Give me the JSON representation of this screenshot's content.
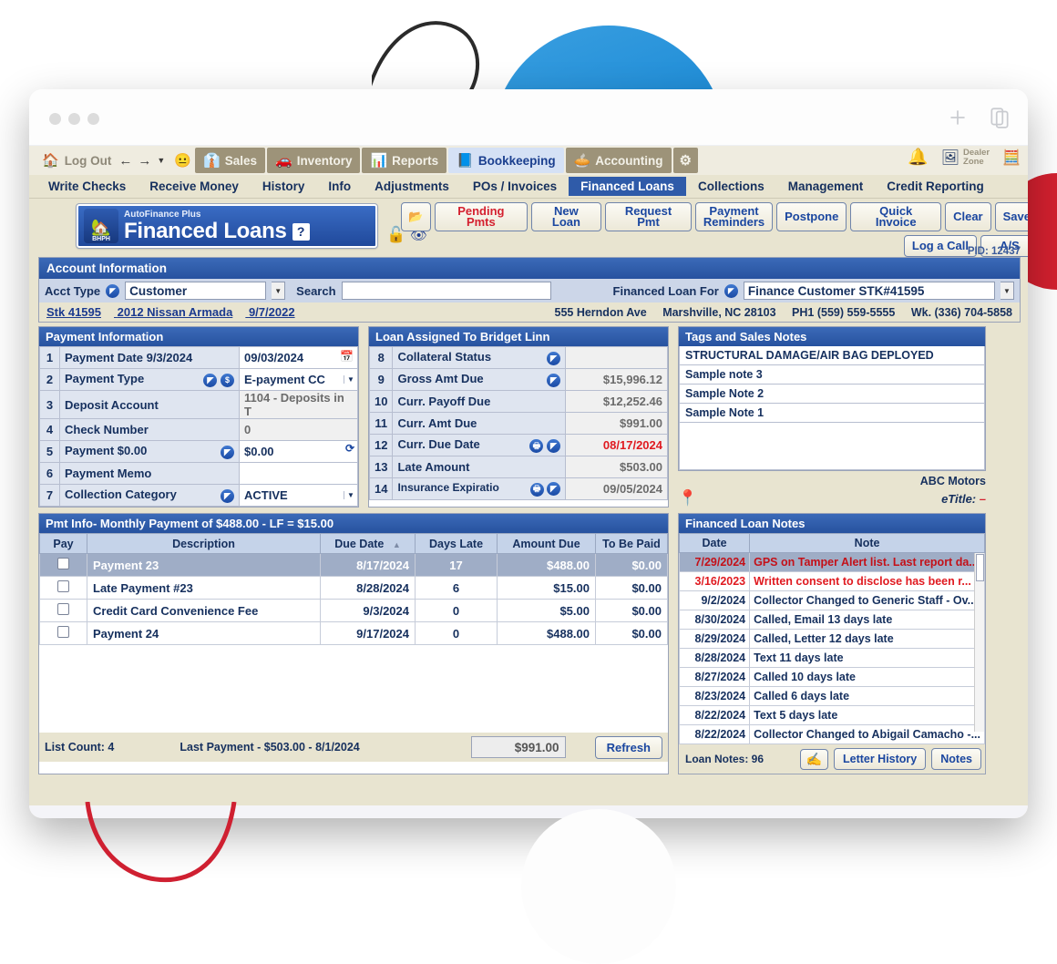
{
  "window": {
    "traffic_dots": [
      "close",
      "minimize",
      "maximize"
    ],
    "actions": [
      "new-tab-plus",
      "copy-tabs"
    ]
  },
  "module_bar": {
    "home_icon": "home-icon",
    "logout_label": "Log Out",
    "back_icon": "back-arrow-icon",
    "forward_icon": "forward-arrow-icon",
    "dropdown_icon": "chevron-down-icon",
    "face_icon": "face-icon",
    "tabs": [
      {
        "label": "Sales",
        "icon": "salesperson-icon",
        "active": false
      },
      {
        "label": "Inventory",
        "icon": "car-icon",
        "active": false
      },
      {
        "label": "Reports",
        "icon": "report-icon",
        "active": false
      },
      {
        "label": "Bookkeeping",
        "icon": "book-icon",
        "active": true
      },
      {
        "label": "Accounting",
        "icon": "pie-chart-icon",
        "active": false
      }
    ],
    "settings_icon": "gear-icon",
    "bell_icon": "bell-icon",
    "dealer_zone_line1": "Dealer",
    "dealer_zone_line2": "Zone",
    "calculator_icon": "calculator-icon"
  },
  "sub_nav": {
    "items": [
      {
        "label": "Write Checks",
        "active": false
      },
      {
        "label": "Receive Money",
        "active": false
      },
      {
        "label": "History",
        "active": false
      },
      {
        "label": "Info",
        "active": false
      },
      {
        "label": "Adjustments",
        "active": false
      },
      {
        "label": "POs / Invoices",
        "active": false
      },
      {
        "label": "Financed Loans",
        "active": true
      },
      {
        "label": "Collections",
        "active": false
      },
      {
        "label": "Management",
        "active": false
      },
      {
        "label": "Credit Reporting",
        "active": false
      }
    ]
  },
  "banner": {
    "logo_text": "BHPH",
    "product": "AutoFinance Plus",
    "title": "Financed Loans",
    "help_glyph": "?",
    "lock_icon": "unlock-icon",
    "eye_icon": "eye-icon"
  },
  "toolbar": {
    "row1": [
      {
        "label": "",
        "name": "folder-button",
        "icon": "folder-icon"
      },
      {
        "label": "Pending Pmts",
        "name": "pending-pmts-button",
        "red": true
      },
      {
        "label": "New Loan",
        "name": "new-loan-button"
      },
      {
        "label": "Request Pmt",
        "name": "request-pmt-button"
      },
      {
        "label": "Payment\nReminders",
        "name": "payment-reminders-button"
      },
      {
        "label": "Postpone",
        "name": "postpone-button"
      },
      {
        "label": "Quick Invoice",
        "name": "quick-invoice-button"
      },
      {
        "label": "Clear",
        "name": "clear-button"
      },
      {
        "label": "Save",
        "name": "save-button"
      }
    ],
    "row2": [
      {
        "label": "Log a Call",
        "name": "log-a-call-button"
      },
      {
        "label": "A/S",
        "name": "as-button"
      }
    ],
    "pid": "PID: 12437"
  },
  "account": {
    "panel_title": "Account Information",
    "acct_type_label": "Acct Type",
    "acct_type_value": "Customer",
    "search_label": "Search",
    "search_value": "",
    "search_placeholder": "",
    "financed_loan_for_label": "Financed Loan For",
    "financed_loan_for_value": "Finance Customer STK#41595",
    "stock": "Stk 41595",
    "vehicle": "2012 Nissan Armada",
    "date": "9/7/2022",
    "address": "555 Herndon Ave",
    "city_state_zip": "Marshville, NC 28103",
    "phone1": "PH1 (559) 559-5555",
    "phone2": "Wk. (336) 704-5858"
  },
  "payment_information": {
    "panel_title": "Payment Information",
    "rows": [
      {
        "n": "1",
        "label": "Payment Date  9/3/2024",
        "value": "09/03/2024",
        "readonly": false,
        "icons": [],
        "trail_icon": "calendar-icon",
        "caret": false
      },
      {
        "n": "2",
        "label": "Payment Type",
        "value": "E-payment CC",
        "readonly": false,
        "icons": [
          "lookup-icon",
          "dollar-icon"
        ],
        "caret": true
      },
      {
        "n": "3",
        "label": "Deposit Account",
        "value": "1104 - Deposits in T",
        "readonly": true,
        "icons": [],
        "caret": false
      },
      {
        "n": "4",
        "label": "Check Number",
        "value": "0",
        "readonly": true,
        "icons": [],
        "caret": false
      },
      {
        "n": "5",
        "label": "Payment  $0.00",
        "value": "$0.00",
        "readonly": false,
        "icons": [
          "lookup-icon"
        ],
        "trail_icon": "refresh-icon",
        "caret": false
      },
      {
        "n": "6",
        "label": "Payment Memo",
        "value": "",
        "readonly": false,
        "icons": [],
        "caret": false
      },
      {
        "n": "7",
        "label": "Collection Category",
        "value": "ACTIVE",
        "readonly": false,
        "icons": [
          "lookup-icon"
        ],
        "caret": true
      }
    ]
  },
  "loan_assigned": {
    "panel_title": "Loan Assigned To Bridget Linn",
    "rows": [
      {
        "n": "8",
        "label": "Collateral Status",
        "value": "",
        "icons": [
          "lookup-icon"
        ],
        "red": false
      },
      {
        "n": "9",
        "label": "Gross Amt Due",
        "value": "$15,996.12",
        "icons": [
          "lookup-icon"
        ],
        "red": false
      },
      {
        "n": "10",
        "label": "Curr. Payoff Due",
        "value": "$12,252.46",
        "icons": [],
        "red": false
      },
      {
        "n": "11",
        "label": "Curr. Amt Due",
        "value": "$991.00",
        "icons": [],
        "red": false
      },
      {
        "n": "12",
        "label": "Curr. Due Date",
        "value": "08/17/2024",
        "icons": [
          "print-icon",
          "lookup-icon"
        ],
        "red": true
      },
      {
        "n": "13",
        "label": "Late Amount",
        "value": "$503.00",
        "icons": [],
        "red": false
      },
      {
        "n": "14",
        "label": "Insurance Expiratio",
        "value": "09/05/2024",
        "icons": [
          "print-icon",
          "lookup-icon"
        ],
        "red": false
      }
    ]
  },
  "tags_and_sales_notes": {
    "panel_title": "Tags and Sales Notes",
    "items": [
      "STRUCTURAL DAMAGE/AIR BAG DEPLOYED",
      "Sample note 3",
      "Sample Note 2",
      "Sample Note 1"
    ],
    "dealer": "ABC Motors",
    "etitle_label": "eTitle:",
    "etitle_value": "–",
    "pin_icon": "map-pin-icon"
  },
  "pmt_info": {
    "panel_title": "Pmt Info- Monthly Payment of $488.00 - LF = $15.00",
    "columns": [
      "Pay",
      "Description",
      "Due Date",
      "Days Late",
      "Amount Due",
      "To Be Paid"
    ],
    "sort_column": "Due Date",
    "sort_dir": "asc",
    "rows": [
      {
        "pay": false,
        "description": "Payment 23",
        "due_date": "8/17/2024",
        "days_late": "17",
        "amount_due": "$488.00",
        "to_be_paid": "$0.00",
        "selected": true
      },
      {
        "pay": false,
        "description": "Late Payment #23",
        "due_date": "8/28/2024",
        "days_late": "6",
        "amount_due": "$15.00",
        "to_be_paid": "$0.00",
        "selected": false
      },
      {
        "pay": false,
        "description": "Credit Card Convenience Fee",
        "due_date": "9/3/2024",
        "days_late": "0",
        "amount_due": "$5.00",
        "to_be_paid": "$0.00",
        "selected": false
      },
      {
        "pay": false,
        "description": "Payment 24",
        "due_date": "9/17/2024",
        "days_late": "0",
        "amount_due": "$488.00",
        "to_be_paid": "$0.00",
        "selected": false
      }
    ],
    "list_count_label": "List Count:  4",
    "last_payment_label": "Last Payment - $503.00 - 8/1/2024",
    "amount_box": "$991.00",
    "refresh_label": "Refresh"
  },
  "financed_loan_notes": {
    "panel_title": "Financed Loan Notes",
    "columns": [
      "Date",
      "Note"
    ],
    "rows": [
      {
        "date": "7/29/2024",
        "note": "GPS on Tamper Alert list. Last report da...",
        "red": true,
        "selected": true
      },
      {
        "date": "3/16/2023",
        "note": "Written consent to disclose has been r...",
        "red": true,
        "selected": false
      },
      {
        "date": "9/2/2024",
        "note": "Collector Changed to Generic Staff - Ov...",
        "red": false,
        "selected": false
      },
      {
        "date": "8/30/2024",
        "note": "Called, Email 13 days late",
        "red": false,
        "selected": false
      },
      {
        "date": "8/29/2024",
        "note": "Called, Letter 12 days late",
        "red": false,
        "selected": false
      },
      {
        "date": "8/28/2024",
        "note": "Text 11 days late",
        "red": false,
        "selected": false
      },
      {
        "date": "8/27/2024",
        "note": "Called 10 days late",
        "red": false,
        "selected": false
      },
      {
        "date": "8/23/2024",
        "note": "Called 6 days late",
        "red": false,
        "selected": false
      },
      {
        "date": "8/22/2024",
        "note": "Text 5 days late",
        "red": false,
        "selected": false
      },
      {
        "date": "8/22/2024",
        "note": "Collector Changed to Abigail Camacho -...",
        "red": false,
        "selected": false
      }
    ],
    "loan_notes_count_label": "Loan Notes:  96",
    "sign_icon": "pen-sign-icon",
    "letter_history_label": "Letter History",
    "notes_label": "Notes"
  },
  "colors": {
    "panel_header_blue": "#27529f",
    "app_bg": "#e8e4d0",
    "accent_red": "#d4202f",
    "link_blue": "#1b3a8f",
    "selected_row": "#9fadc6",
    "deco_blue": "#1b8ad6",
    "deco_red": "#d3202f"
  }
}
